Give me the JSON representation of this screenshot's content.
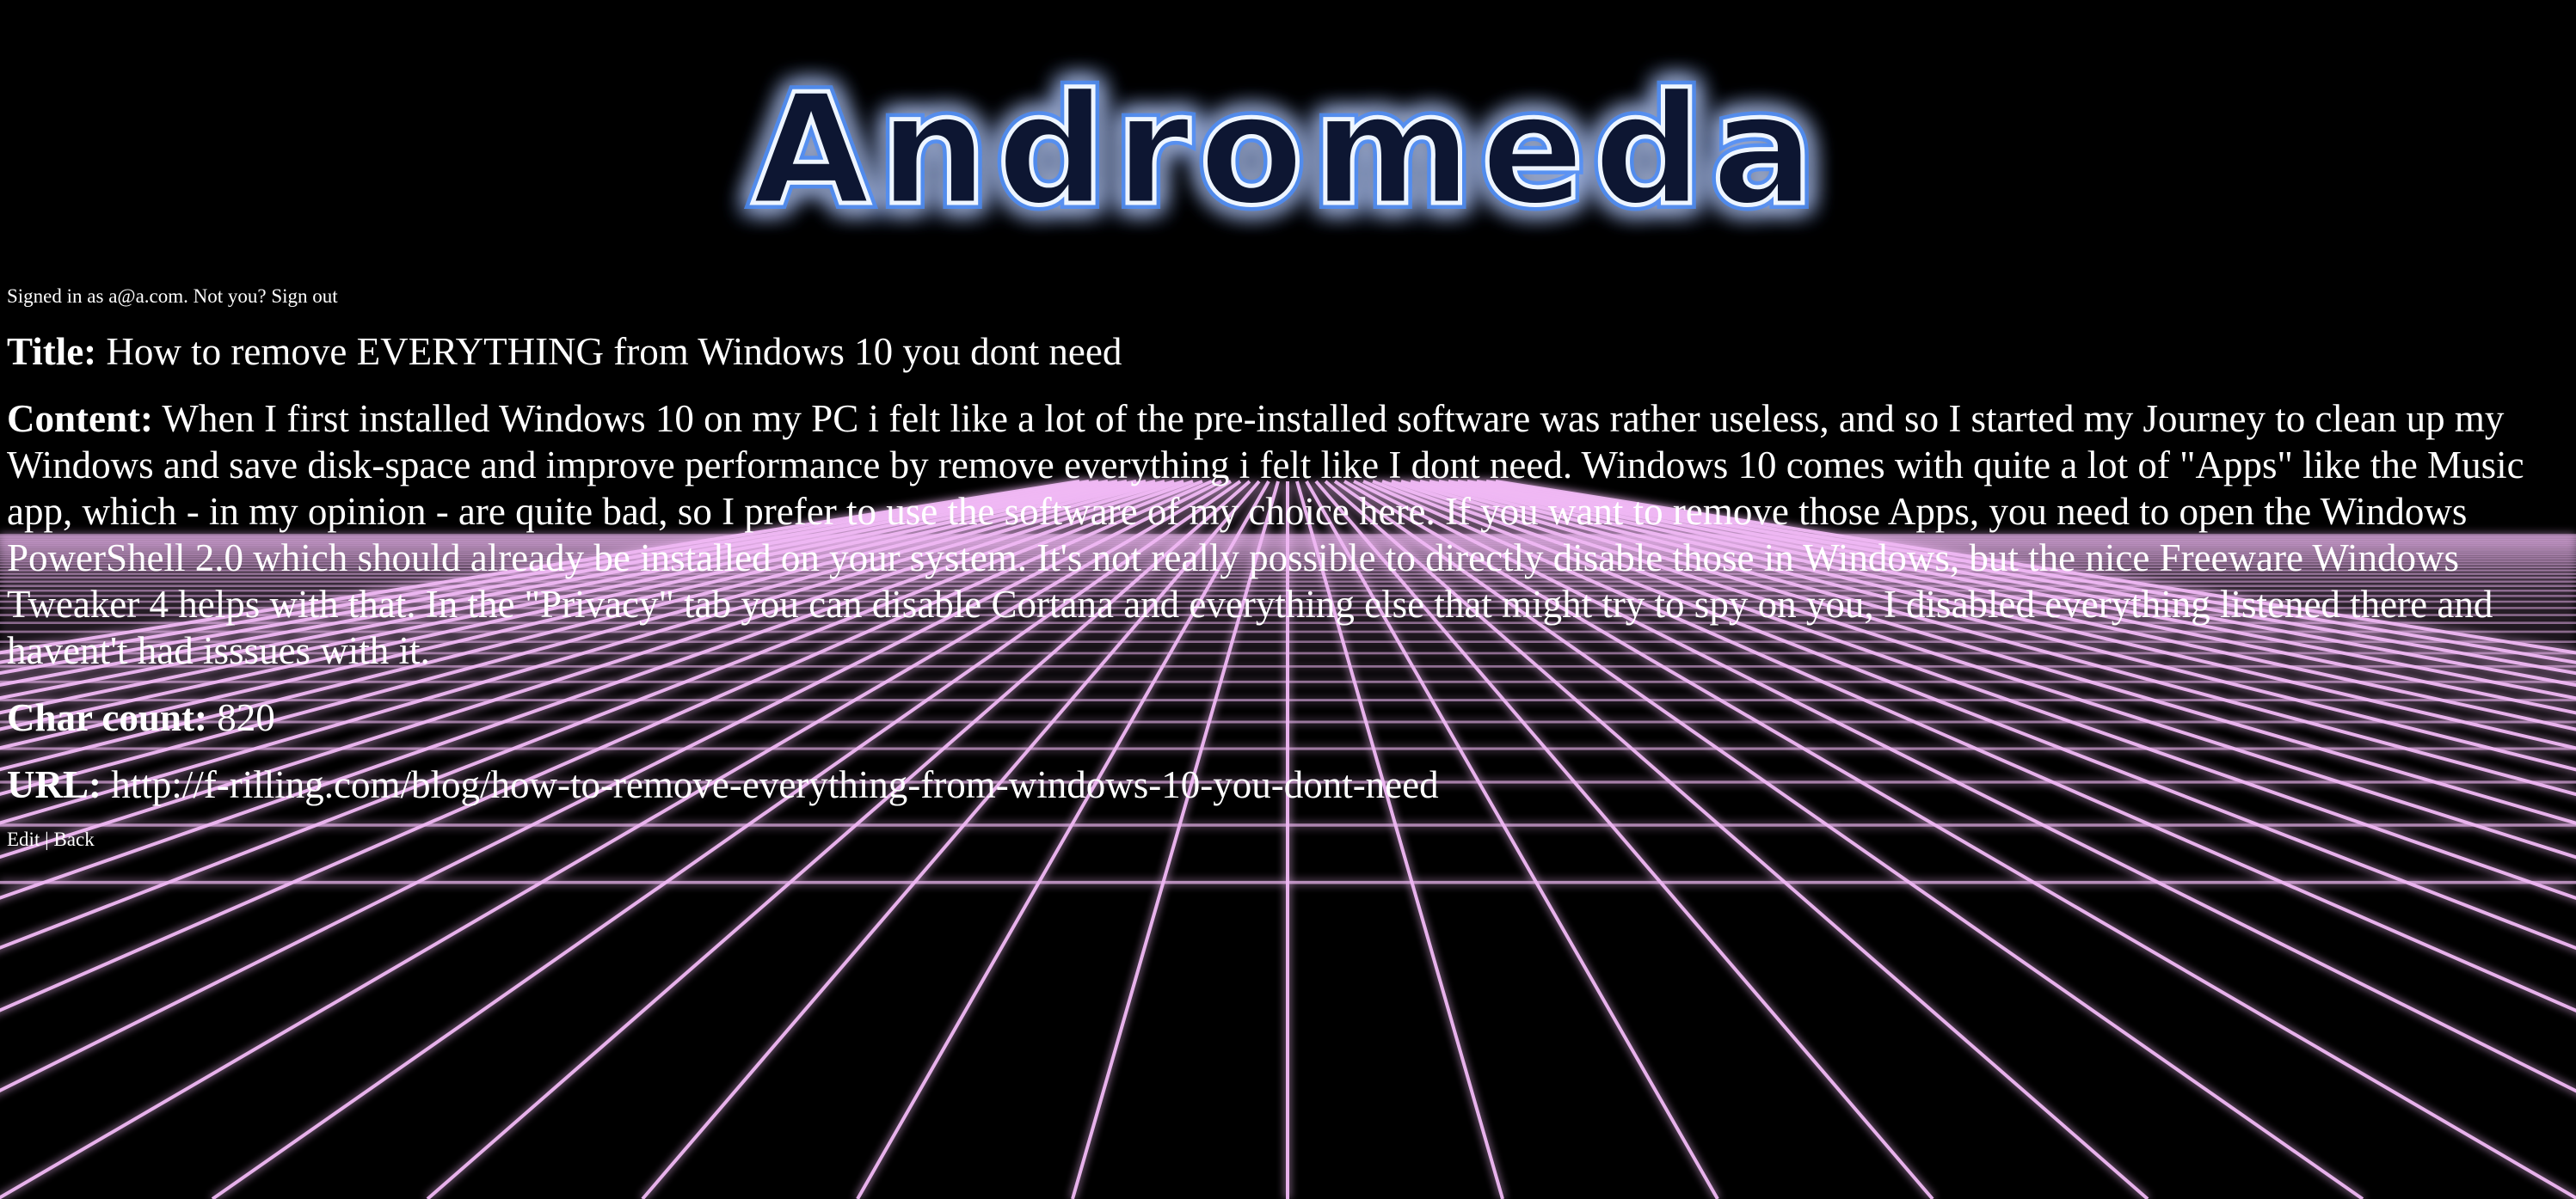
{
  "app": {
    "logo_text": "Andromeda"
  },
  "auth": {
    "signed_in_prefix": "Signed in as",
    "email": "a@a.com.",
    "not_you": "Not you?",
    "sign_out": "Sign out"
  },
  "post": {
    "title_label": "Title:",
    "title": "How to remove EVERYTHING from Windows 10 you dont need",
    "content_label": "Content:",
    "content": "When I first installed Windows 10 on my PC i felt like a lot of the pre-installed software was rather useless, and so I started my Journey to clean up my Windows and save disk-space and improve performance by remove everything i felt like I dont need. Windows 10 comes with quite a lot of \"Apps\" like the Music app, which - in my opinion - are quite bad, so I prefer to use the software of my choice here. If you want to remove those Apps, you need to open the Windows PowerShell 2.0 which should already be installed on your system. It's not really possible to directly disable those in Windows, but the nice Freeware Windows Tweaker 4 helps with that. In the \"Privacy\" tab you can disable Cortana and everything else that might try to spy on you, I disabled everything listened there and havent't had isssues with it.",
    "char_count_label": "Char count:",
    "char_count": "820",
    "url_label": "URL:",
    "url": "http://f-rilling.com/blog/how-to-remove-everything-from-windows-10-you-dont-need"
  },
  "actions": {
    "edit": "Edit",
    "separator": "|",
    "back": "Back"
  },
  "colors": {
    "background": "#000000",
    "text": "#ffffff",
    "grid_line": "#f0b8f4",
    "grid_glow": "#d04ae0",
    "logo_glow": "#3a8cff",
    "logo_stroke": "#e8f2ff"
  }
}
